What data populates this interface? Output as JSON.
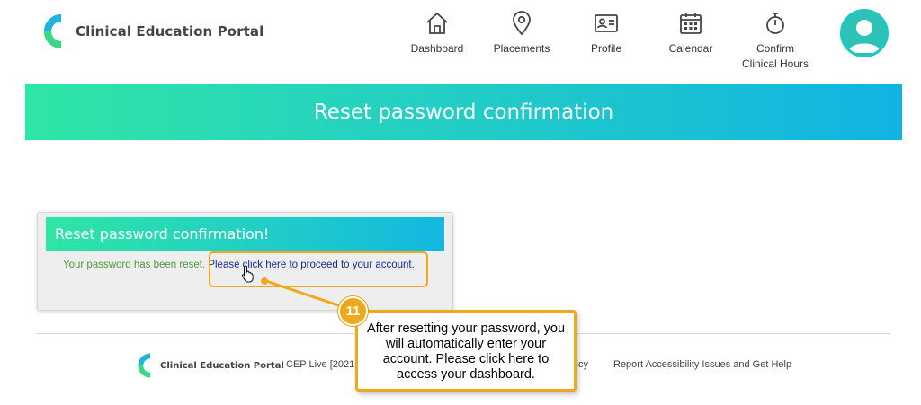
{
  "header": {
    "app_name": "Clinical Education Portal",
    "nav": [
      {
        "label": "Dashboard",
        "icon": "home-icon"
      },
      {
        "label": "Placements",
        "icon": "map-pin-icon"
      },
      {
        "label": "Profile",
        "icon": "id-card-icon"
      },
      {
        "label": "Calendar",
        "icon": "calendar-icon"
      },
      {
        "label": "Confirm\nClinical Hours",
        "icon": "stopwatch-icon"
      }
    ],
    "avatar_icon": "user-avatar-icon"
  },
  "banner": {
    "title": "Reset password confirmation"
  },
  "panel": {
    "title": "Reset password confirmation!",
    "message": "Your password has been reset.",
    "link_text": "Please click here to proceed to your account",
    "link_suffix": "."
  },
  "footer": {
    "app_name": "Clinical Education Portal",
    "version": "CEP Live [2021.(",
    "policy": "olicy",
    "accessibility": "Report Accessibility Issues and Get Help"
  },
  "callout": {
    "step_number": "11",
    "text": "After resetting your password, you will automatically enter your account. Please click here to access your dashboard."
  },
  "colors": {
    "accent_orange": "#f0a81c",
    "gradient_start": "#2ee6a5",
    "gradient_end": "#0fb4e2",
    "success_text": "#4a9a3a",
    "link": "#1a2a8c"
  }
}
